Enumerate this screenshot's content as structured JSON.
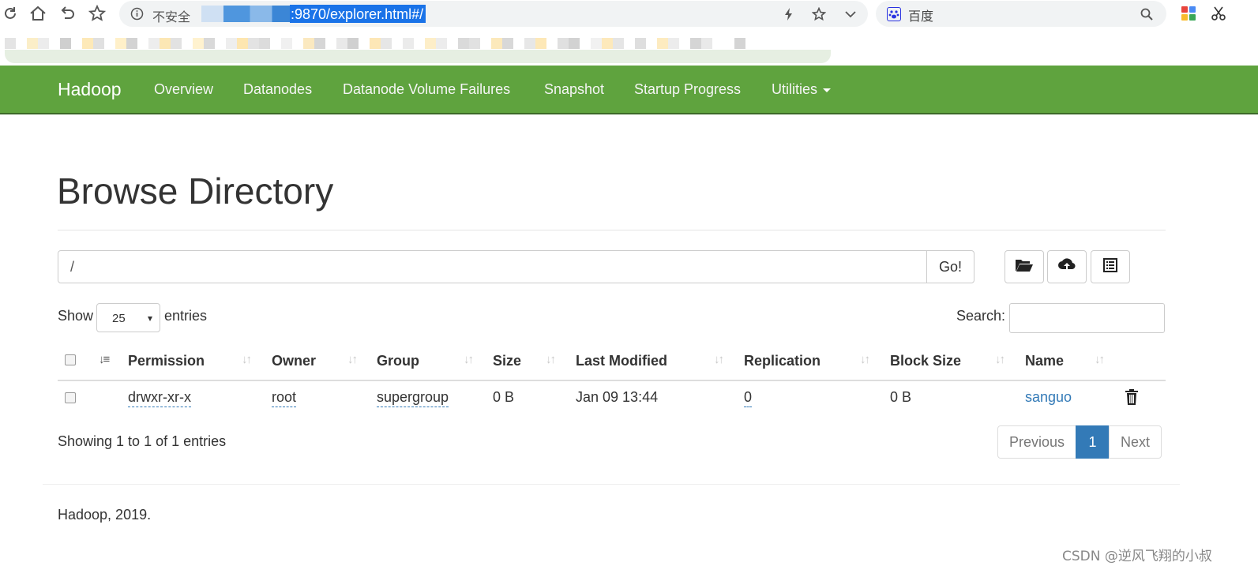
{
  "browser": {
    "security_label": "不安全",
    "url_visible": ":9870/explorer.html#/",
    "search_engine": "百度"
  },
  "navbar": {
    "brand": "Hadoop",
    "items": [
      "Overview",
      "Datanodes",
      "Datanode Volume Failures",
      "Snapshot",
      "Startup Progress",
      "Utilities"
    ],
    "color": "#5fa33e"
  },
  "page": {
    "title": "Browse Directory",
    "path_value": "/",
    "go_label": "Go!",
    "toolbar_icons": [
      "folder-open-icon",
      "cloud-upload-icon",
      "list-alt-icon"
    ]
  },
  "table_controls": {
    "show_label": "Show",
    "entries_value": "25",
    "entries_label": "entries",
    "search_label": "Search:",
    "search_value": ""
  },
  "table": {
    "columns": [
      "Permission",
      "Owner",
      "Group",
      "Size",
      "Last Modified",
      "Replication",
      "Block Size",
      "Name"
    ],
    "rows": [
      {
        "permission": "drwxr-xr-x",
        "owner": "root",
        "group": "supergroup",
        "size": "0 B",
        "last_modified": "Jan 09 13:44",
        "replication": "0",
        "block_size": "0 B",
        "name": "sanguo"
      }
    ]
  },
  "pagination": {
    "info": "Showing 1 to 1 of 1 entries",
    "previous": "Previous",
    "current": "1",
    "next": "Next"
  },
  "footer": "Hadoop, 2019.",
  "watermark": "CSDN @逆风飞翔的小叔",
  "colors": {
    "accent": "#337ab7",
    "navbar": "#5fa33e"
  }
}
